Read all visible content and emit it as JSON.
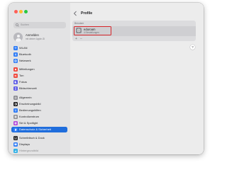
{
  "colors": {
    "accent": "#1f6ddc",
    "highlight_border": "#d7262b"
  },
  "search": {
    "placeholder": "Suchen",
    "icon": "magnifier-icon"
  },
  "account": {
    "name": "Anmelden",
    "subtitle": "mit deiner Apple-ID"
  },
  "sidebar": {
    "items": [
      {
        "label": "WLAN",
        "icon": "wifi-icon",
        "color": "#2f7cf6"
      },
      {
        "label": "Bluetooth",
        "icon": "bluetooth-icon",
        "color": "#2f7cf6"
      },
      {
        "label": "Netzwerk",
        "icon": "globe-icon",
        "color": "#2f7cf6"
      },
      {
        "label": "Mitteilungen",
        "icon": "bell-icon",
        "color": "#ef4b3f"
      },
      {
        "label": "Ton",
        "icon": "speaker-icon",
        "color": "#ef4b3f"
      },
      {
        "label": "Fokus",
        "icon": "moon-icon",
        "color": "#5e5ce6"
      },
      {
        "label": "Bildschirmzeit",
        "icon": "hourglass-icon",
        "color": "#5e5ce6"
      },
      {
        "label": "Allgemein",
        "icon": "gear-icon",
        "color": "#8e8e93"
      },
      {
        "label": "Erscheinungsbild",
        "icon": "appearance-icon",
        "color": "#1d1d1f"
      },
      {
        "label": "Bedienungshilfen",
        "icon": "accessibility-icon",
        "color": "#2f7cf6"
      },
      {
        "label": "Kontrollzentrum",
        "icon": "control-center-icon",
        "color": "#8e8e93"
      },
      {
        "label": "Siri & Spotlight",
        "icon": "siri-icon",
        "color": "#b44cd9"
      },
      {
        "label": "Datenschutz & Sicherheit",
        "icon": "hand-icon",
        "color": "#2f7cf6"
      },
      {
        "label": "Schreibtisch & Dock",
        "icon": "dock-icon",
        "color": "#1d1d1f"
      },
      {
        "label": "Displays",
        "icon": "display-icon",
        "color": "#2f7cf6"
      },
      {
        "label": "Hintergrundbild",
        "icon": "wallpaper-icon",
        "color": "#2fb0e6"
      }
    ]
  },
  "main": {
    "back_icon": "chevron-left-icon",
    "title": "Profile",
    "panel_header": "Benutzer",
    "profile": {
      "name": "eduroam",
      "subtitle": "4 Einstellungen",
      "icon": "gear-badge-icon"
    },
    "add_label": "+",
    "remove_label": "−",
    "help_label": "?"
  }
}
